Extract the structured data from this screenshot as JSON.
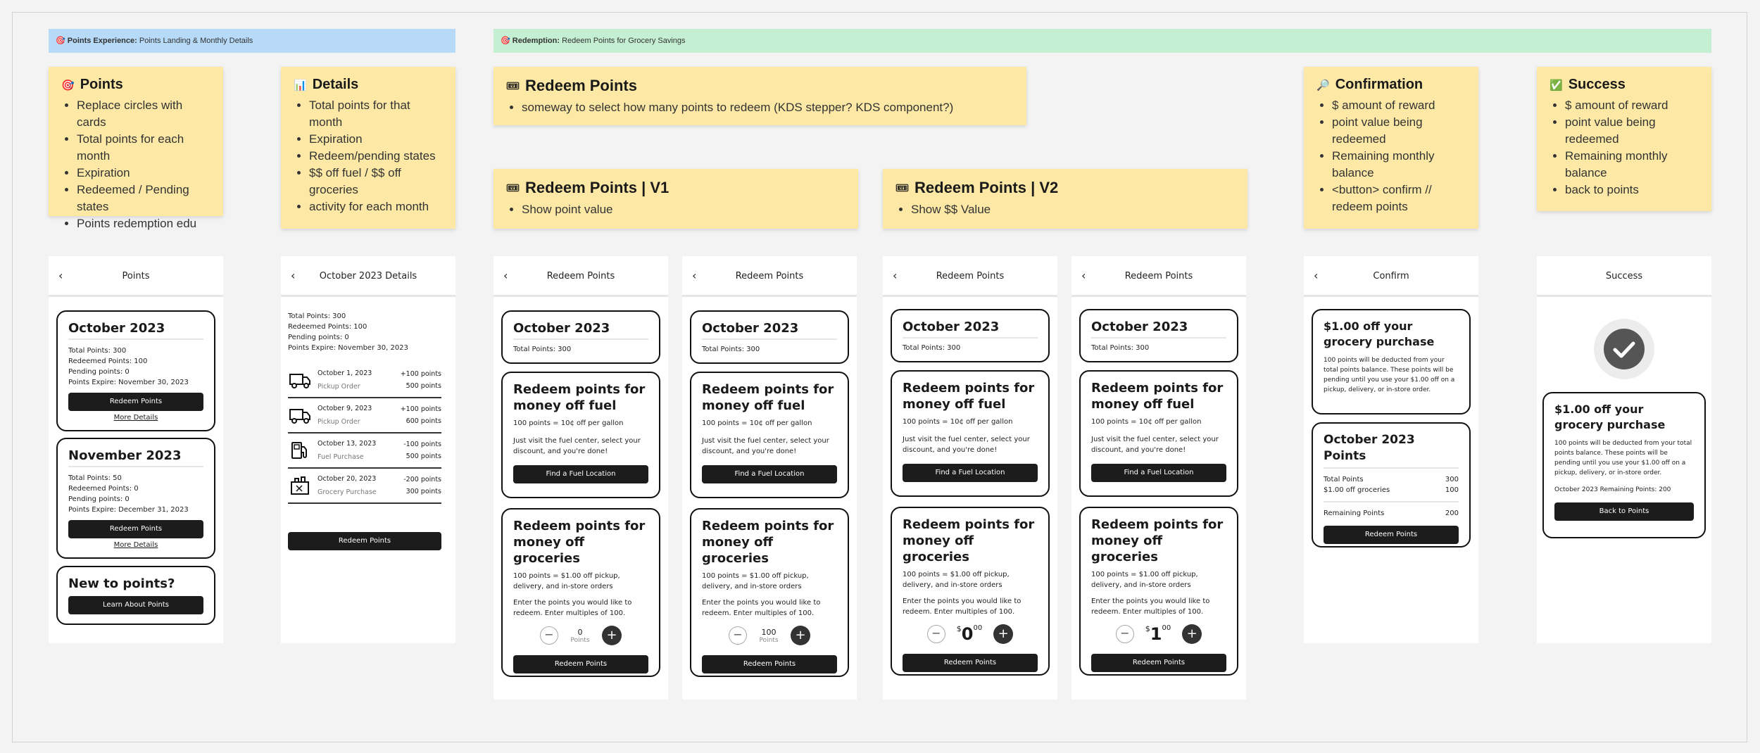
{
  "banners": {
    "points_experience": {
      "title": "Points Experience:",
      "subtitle": "Points Landing & Monthly Details"
    },
    "redemption": {
      "title": "Redemption:",
      "subtitle": "Redeem Points for Grocery Savings"
    }
  },
  "stickies": {
    "points": {
      "emoji": "🎯",
      "title": "Points",
      "items": [
        "Replace circles with cards",
        "Total points for each month",
        "Expiration",
        "Redeemed / Pending states",
        "Points redemption edu"
      ]
    },
    "details": {
      "emoji": "📊",
      "title": "Details",
      "items": [
        "Total points for that month",
        "Expiration",
        "Redeem/pending states",
        "$$ off fuel / $$ off groceries",
        "activity for each month"
      ]
    },
    "redeem": {
      "emoji": "🎟",
      "title": "Redeem Points",
      "items": [
        "someway to select how many points to redeem (KDS stepper? KDS component?)"
      ]
    },
    "redeem_v1": {
      "emoji": "🎟",
      "title": "Redeem Points | V1",
      "items": [
        "Show point value"
      ]
    },
    "redeem_v2": {
      "emoji": "🎟",
      "title": "Redeem Points | V2",
      "items": [
        "Show $$ Value"
      ]
    },
    "confirmation": {
      "emoji": "🔎",
      "title": "Confirmation",
      "items": [
        "$ amount of reward",
        "point value being redeemed",
        "Remaining monthly balance",
        "<button> confirm // redeem points"
      ]
    },
    "success": {
      "emoji": "✅",
      "title": "Success",
      "items": [
        "$ amount of reward",
        "point value being redeemed",
        "Remaining monthly balance",
        "back to points"
      ]
    }
  },
  "points_screen": {
    "title": "Points",
    "october": {
      "title": "October 2023",
      "total": "Total Points: 300",
      "redeemed": "Redeemed Points: 100",
      "pending": "Pending points: 0",
      "expire": "Points Expire: November 30, 2023",
      "button": "Redeem Points",
      "link": "More Details"
    },
    "november": {
      "title": "November 2023",
      "total": "Total Points: 50",
      "redeemed": "Redeemed Points: 0",
      "pending": "Pending points: 0",
      "expire": "Points Expire: December 31, 2023",
      "button": "Redeem Points",
      "link": "More Details"
    },
    "new": {
      "title": "New to points?",
      "button": "Learn About Points"
    }
  },
  "details_screen": {
    "title": "October 2023 Details",
    "total": "Total Points: 300",
    "redeemed": "Redeemed Points: 100",
    "pending": "Pending points: 0",
    "expire": "Points Expire: November 30, 2023",
    "activity": [
      {
        "icon": "truck-icon",
        "date": "October 1, 2023",
        "type": "Pickup Order",
        "delta": "+100 points",
        "balance": "500 points"
      },
      {
        "icon": "truck-icon",
        "date": "October 9, 2023",
        "type": "Pickup Order",
        "delta": "+100 points",
        "balance": "600 points"
      },
      {
        "icon": "fuel-pump-icon",
        "date": "October 13, 2023",
        "type": "Fuel Purchase",
        "delta": "-100 points",
        "balance": "500 points"
      },
      {
        "icon": "grocery-bag-icon",
        "date": "October 20, 2023",
        "type": "Grocery Purchase",
        "delta": "-200 points",
        "balance": "300 points"
      }
    ],
    "button": "Redeem Points"
  },
  "redeem_common": {
    "screen_title": "Redeem Points",
    "month_title": "October 2023",
    "month_total": "Total Points: 300",
    "fuel_title": "Redeem points for money off fuel",
    "fuel_rate": "100 points = 10¢ off per gallon",
    "fuel_desc": "Just visit the fuel center, select your discount, and you're done!",
    "fuel_button": "Find a Fuel Location",
    "groc_title": "Redeem points for money off groceries",
    "groc_rate": "100 points = $1.00 off pickup, delivery, and in-store orders",
    "groc_desc": "Enter the points you would like to redeem. Enter multiples of 100.",
    "groc_button": "Redeem Points",
    "unit": "Points"
  },
  "redeem_values": {
    "v1a": "0",
    "v1b": "100",
    "v2a": {
      "dollar": "$",
      "whole": "0",
      "cents": "00"
    },
    "v2b": {
      "dollar": "$",
      "whole": "1",
      "cents": "00"
    }
  },
  "confirm_screen": {
    "title": "Confirm",
    "reward": "$1.00 off your grocery purchase",
    "desc": "100 points will be deducted from your total points balance. These points will be pending until you use your $1.00 off on a pickup, delivery, or in-store order.",
    "summary_title": "October 2023 Points",
    "rows": [
      {
        "label": "Total Points",
        "value": "300"
      },
      {
        "label": "$1.00 off groceries",
        "value": "100"
      }
    ],
    "remaining_label": "Remaining Points",
    "remaining_value": "200",
    "button": "Redeem Points"
  },
  "success_screen": {
    "title": "Success",
    "reward": "$1.00 off your grocery purchase",
    "desc": "100 points will be deducted from your total points balance. These points will be pending until you use your $1.00 off on a pickup, delivery, or in-store order.",
    "remaining": "October 2023 Remaining Points: 200",
    "button": "Back to Points"
  }
}
